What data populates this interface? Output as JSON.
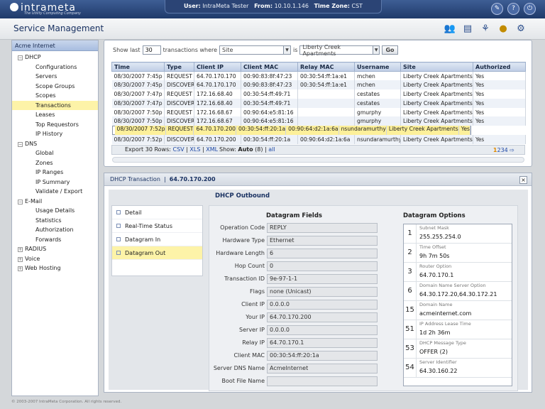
{
  "topbar": {
    "brand": "intrameta",
    "tagline": "The Utility Computing Company",
    "user_label": "User:",
    "user": "IntraMeta Tester",
    "from_label": "From:",
    "from": "10.10.1.146",
    "tz_label": "Time Zone:",
    "tz": "CST",
    "icons": [
      "wrench-icon",
      "help-icon",
      "power-icon"
    ]
  },
  "header": {
    "title": "Service Management",
    "icons": [
      "users-icon",
      "document-icon",
      "network-icon",
      "globe-icon",
      "gears-icon"
    ]
  },
  "sidebar": {
    "account": "Acme Internet",
    "dhcp": "DHCP",
    "dhcp_items": [
      "Configurations",
      "Servers",
      "Scope Groups",
      "Scopes",
      "Transactions",
      "Leases",
      "Top Requestors",
      "IP History"
    ],
    "dns": "DNS",
    "dns_items": [
      "Global",
      "Zones",
      "IP Ranges",
      "IP Summary",
      "Validate / Export"
    ],
    "email": "E-Mail",
    "email_items": [
      "Usage Details",
      "Statistics",
      "Authorization",
      "Forwards"
    ],
    "radius": "RADIUS",
    "voice": "Voice",
    "webhosting": "Web Hosting"
  },
  "filter": {
    "show_last": "Show last",
    "count": "30",
    "transactions_where": "transactions where",
    "field": "Site",
    "is": "is",
    "value": "Liberty Creek Apartments",
    "go": "Go"
  },
  "grid": {
    "columns": [
      "Time",
      "Type",
      "Client IP",
      "Client MAC",
      "Relay MAC",
      "Username",
      "Site",
      "Authorized"
    ],
    "rows": [
      [
        "08/30/2007 7:45p",
        "REQUEST",
        "64.70.170.170",
        "00:90:83:8f:47:23",
        "00:30:54:ff:1a:e1",
        "mchen",
        "Liberty Creek Apartments",
        "Yes"
      ],
      [
        "08/30/2007 7:45p",
        "DISCOVER",
        "64.70.170.170",
        "00:90:83:8f:47:23",
        "00:30:54:ff:1a:e1",
        "mchen",
        "Liberty Creek Apartments",
        "Yes"
      ],
      [
        "08/30/2007 7:47p",
        "REQUEST",
        "172.16.68.40",
        "00:30:54:ff:49:71",
        "",
        "cestates",
        "Liberty Creek Apartments",
        "Yes"
      ],
      [
        "08/30/2007 7:47p",
        "DISCOVER",
        "172.16.68.40",
        "00:30:54:ff:49:71",
        "",
        "cestates",
        "Liberty Creek Apartments",
        "Yes"
      ],
      [
        "08/30/2007 7:50p",
        "REQUEST",
        "172.16.68.67",
        "00:90:64:e5:81:16",
        "",
        "gmurphy",
        "Liberty Creek Apartments",
        "Yes"
      ],
      [
        "08/30/2007 7:50p",
        "DISCOVER",
        "172.16.68.67",
        "00:90:64:e5:81:16",
        "",
        "gmurphy",
        "Liberty Creek Apartments",
        "Yes"
      ],
      [
        "08/30/2007 7:52p",
        "REQUEST",
        "64.70.170.200",
        "00:30:54:ff:20:1a",
        "00:90:64:d2:1a:6a",
        "nsundaramurthy",
        "Liberty Creek Apartments",
        "Yes"
      ],
      [
        "08/30/2007 7:52p",
        "DISCOVER",
        "64.70.170.200",
        "00:30:54:ff:20:1a",
        "00:90:64:d2:1a:6a",
        "nsundaramurthy",
        "Liberty Creek Apartments",
        "Yes"
      ]
    ],
    "export_label": "Export 30 Rows:",
    "csv": "CSV",
    "xls": "XLS",
    "xml": "XML",
    "show_label": "Show:",
    "show_auto": "Auto",
    "show_count": "(8)",
    "show_all": "all",
    "pages": [
      "1",
      "2",
      "3",
      "4"
    ]
  },
  "panel": {
    "title": "DHCP Transaction",
    "ip": "64.70.170.200",
    "tabs": [
      "Detail",
      "Real-Time Status",
      "Datagram In",
      "Datagram Out"
    ],
    "section": "DHCP Outbound",
    "fields_head": "Datagram Fields",
    "options_head": "Datagram Options",
    "fields": [
      {
        "label": "Operation Code",
        "value": "REPLY"
      },
      {
        "label": "Hardware Type",
        "value": "Ethernet"
      },
      {
        "label": "Hardware Length",
        "value": "6"
      },
      {
        "label": "Hop Count",
        "value": "0"
      },
      {
        "label": "Transaction ID",
        "value": "9e-97-1-1"
      },
      {
        "label": "Flags",
        "value": "none (Unicast)"
      },
      {
        "label": "Client IP",
        "value": "0.0.0.0"
      },
      {
        "label": "Your IP",
        "value": "64.70.170.200"
      },
      {
        "label": "Server IP",
        "value": "0.0.0.0"
      },
      {
        "label": "Relay IP",
        "value": "64.70.170.1"
      },
      {
        "label": "Client MAC",
        "value": "00:30:54:ff:20:1a"
      },
      {
        "label": "Server DNS Name",
        "value": "AcmeInternet"
      },
      {
        "label": "Boot File Name",
        "value": ""
      }
    ],
    "options": [
      {
        "num": "1",
        "name": "Subnet Mask",
        "value": "255.255.254.0"
      },
      {
        "num": "2",
        "name": "Time Offset",
        "value": "9h 7m 50s"
      },
      {
        "num": "3",
        "name": "Router Option",
        "value": "64.70.170.1"
      },
      {
        "num": "6",
        "name": "Domain Name Server Option",
        "value": "64.30.172.20,64.30.172.21"
      },
      {
        "num": "15",
        "name": "Domain Name",
        "value": "acmeinternet.com"
      },
      {
        "num": "51",
        "name": "IP Address Lease Time",
        "value": "1d 2h 36m"
      },
      {
        "num": "53",
        "name": "DHCP Message Type",
        "value": "OFFER (2)"
      },
      {
        "num": "54",
        "name": "Server Identifier",
        "value": "64.30.160.22"
      }
    ]
  },
  "footer": "© 2003-2007 IntraMeta Corporation. All rights reserved."
}
